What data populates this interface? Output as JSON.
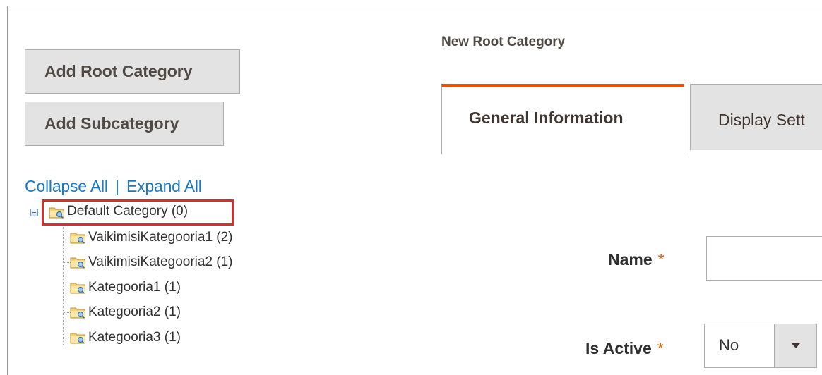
{
  "buttons": {
    "add_root": "Add Root Category",
    "add_sub": "Add Subcategory"
  },
  "tree": {
    "collapse_all": "Collapse All",
    "separator": "|",
    "expand_all": "Expand All",
    "root": "Default Category (0)",
    "children": [
      "VaikimisiKategooria1 (2)",
      "VaikimisiKategooria2 (1)",
      "Kategooria1 (1)",
      "Kategooria2 (1)",
      "Kategooria3 (1)"
    ]
  },
  "form": {
    "heading": "New Root Category",
    "tabs": [
      "General Information",
      "Display Sett"
    ],
    "name_label": "Name",
    "name_value": "",
    "is_active_label": "Is Active",
    "is_active_value": "No",
    "required_mark": "*"
  },
  "colors": {
    "accent": "#eb5202",
    "link": "#1979c3",
    "highlight": "#e02b27"
  }
}
